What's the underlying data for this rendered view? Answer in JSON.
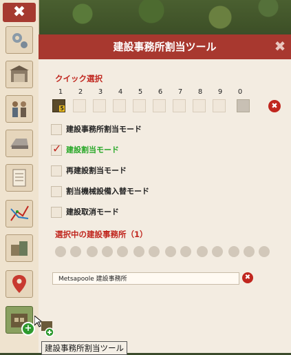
{
  "sidebar": {
    "close_label": "✖",
    "buttons": [
      {
        "name": "gear-icon"
      },
      {
        "name": "garage-icon"
      },
      {
        "name": "people-icon"
      },
      {
        "name": "vehicle-icon"
      },
      {
        "name": "document-icon"
      },
      {
        "name": "route-map-icon"
      },
      {
        "name": "buildings-icon"
      },
      {
        "name": "location-pin-icon"
      },
      {
        "name": "depot-assign-icon"
      }
    ]
  },
  "panel": {
    "title": "建設事務所割当ツール",
    "close_label": "✖",
    "quick_select_label": "クイック選択",
    "slot_numbers": [
      "1",
      "2",
      "3",
      "4",
      "5",
      "6",
      "7",
      "8",
      "9",
      "0"
    ],
    "slot1_badge": "5",
    "clear_label": "✖",
    "modes": [
      {
        "label": "建設事務所割当モード",
        "checked": false
      },
      {
        "label": "建設割当モード",
        "checked": true
      },
      {
        "label": "再建設割当モード",
        "checked": false
      },
      {
        "label": "割当機械設備入替モード",
        "checked": false
      },
      {
        "label": "建設取消モード",
        "checked": false
      }
    ],
    "check_mark": "✓",
    "selected_header": "選択中の建設事務所（1）",
    "depot_value": "Metsapoole 建設事務所",
    "depot_clear_label": "✖"
  },
  "tooltip": "建設事務所割当ツール",
  "colors": {
    "header": "#a8382f",
    "accent_red": "#c0261e",
    "active_green": "#28a828",
    "panel_bg": "#f3ece1"
  }
}
